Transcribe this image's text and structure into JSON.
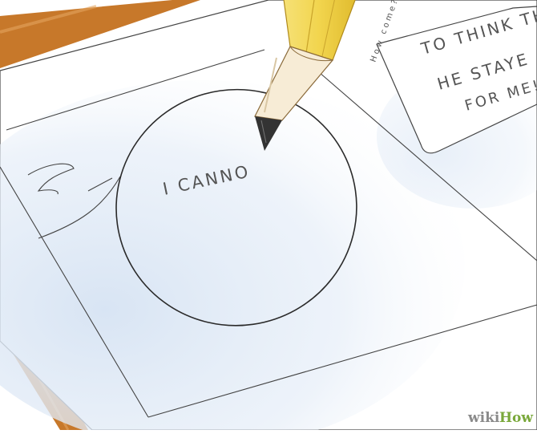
{
  "speech_bubble_text": "I CANNO",
  "side_note": {
    "line1": "TO THINK TH",
    "line2": "HE STAYE",
    "line3": "FOR ME!"
  },
  "margin_note": "How come?",
  "watermark": {
    "wiki": "wiki",
    "how": "How"
  },
  "colors": {
    "desk_frame": "#c7782a",
    "paper_shadow": "#dbe6f3",
    "pencil_body": "#f2d54e",
    "pencil_wood": "#f7ecd6",
    "pencil_lead": "#333333",
    "watermark_green": "#79a83a"
  },
  "icons": [
    "pencil-icon"
  ]
}
